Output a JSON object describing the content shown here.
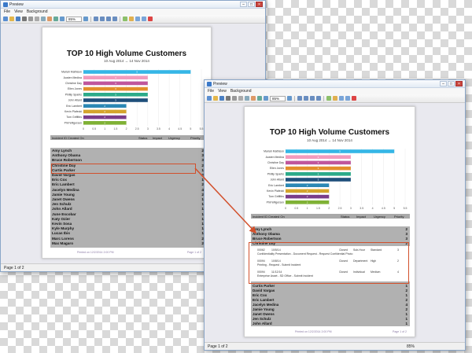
{
  "window_title": "Preview",
  "menu": [
    "File",
    "View",
    "Background"
  ],
  "zoom": "85%",
  "status_left": "Page 1 of 2",
  "report": {
    "title": "TOP 10 High Volume Customers",
    "date_range": "10 Aug 2014  →  14 Nov 2014",
    "columns": [
      "Incident ID",
      "Created On",
      "Status",
      "Impact",
      "Urgency",
      "Priority"
    ],
    "footer_left": "Printed on 12/2/2014 2:00 PM",
    "footer_right": "Page 1 of 2"
  },
  "customers": [
    {
      "name": "Amy Lynch",
      "priority": "2"
    },
    {
      "name": "Anthony Obama",
      "priority": "3"
    },
    {
      "name": "Bruce Robertson",
      "priority": "3"
    },
    {
      "name": "Christine Day",
      "priority": "2"
    },
    {
      "name": "Curtis Parker",
      "priority": "1"
    },
    {
      "name": "David Vargas",
      "priority": "2"
    },
    {
      "name": "Eric Cox",
      "priority": "1"
    },
    {
      "name": "Eric Lambert",
      "priority": "2"
    },
    {
      "name": "Jacelyn Medina",
      "priority": "4"
    },
    {
      "name": "Jamie Young",
      "priority": "2"
    },
    {
      "name": "Janet Owens",
      "priority": "1"
    },
    {
      "name": "Jen Schulz",
      "priority": "1"
    },
    {
      "name": "John Allard",
      "priority": "1"
    },
    {
      "name": "June Escobar",
      "priority": "1"
    },
    {
      "name": "Katy Ozier",
      "priority": "1"
    },
    {
      "name": "Kevin Sosa",
      "priority": "1"
    },
    {
      "name": "Kyle Murphy",
      "priority": "1"
    },
    {
      "name": "Lucas Ibis",
      "priority": "1"
    },
    {
      "name": "Marc Lorens",
      "priority": "2"
    },
    {
      "name": "Max Magaro",
      "priority": "2"
    }
  ],
  "customers_right": [
    {
      "name": "Amy Lynch",
      "priority": "2"
    },
    {
      "name": "Anthony Obama",
      "priority": "3"
    },
    {
      "name": "Bruce Robertson",
      "priority": "3"
    },
    {
      "name": "Christine Day",
      "priority": "2"
    },
    {
      "name": "Curtis Parker",
      "priority": "1"
    },
    {
      "name": "David Vargas",
      "priority": "2"
    },
    {
      "name": "Eric Cox",
      "priority": "1"
    },
    {
      "name": "Eric Lambert",
      "priority": "2"
    },
    {
      "name": "Jacelyn Medina",
      "priority": "4"
    },
    {
      "name": "Jamie Young",
      "priority": "2"
    },
    {
      "name": "Janet Owens",
      "priority": "1"
    },
    {
      "name": "Jen Schulz",
      "priority": "1"
    },
    {
      "name": "John Allard",
      "priority": "1"
    }
  ],
  "detail_rows": [
    {
      "id": "00062",
      "created": "10/5/14",
      "status": "Closed",
      "impact": "Sub-Hour",
      "urgency": "Standard",
      "priority": "3",
      "desc": "Confidentiality Presentation - Document Request - Request Confidential Photo"
    },
    {
      "id": "00094",
      "created": "10/8/14",
      "status": "Closed",
      "impact": "Department",
      "urgency": "High",
      "priority": "2",
      "desc": "Printing - Request - Submit Incident"
    },
    {
      "id": "00094",
      "created": "11/12/14",
      "status": "Closed",
      "impact": "Individual",
      "urgency": "Medium",
      "priority": "4",
      "desc": "Enterprise Asset - SD Office - Submit Incident"
    }
  ],
  "status_right_zoom": "85%",
  "chart_data": {
    "type": "bar",
    "orientation": "horizontal",
    "categories": [
      "Mariah Mathison",
      "Austen Medina",
      "Christine Day",
      "Ellen Jones",
      "Phillip Sparks",
      "John Allard",
      "Eric Lambert",
      "Kevin Plafecki",
      "Tom Griffiths",
      "Phil Wilgersen"
    ],
    "values": [
      5,
      3,
      3,
      3,
      3,
      3,
      2,
      2,
      2,
      2
    ],
    "colors": [
      "#35b6e6",
      "#f29bbd",
      "#c0569c",
      "#e38f2c",
      "#2cab8a",
      "#1f4f7b",
      "#2b88b5",
      "#d4a42c",
      "#7a3c8a",
      "#7fb135"
    ],
    "xlim": [
      0,
      5.5
    ],
    "ticks": [
      "0",
      "0.5",
      "1",
      "1.5",
      "2",
      "2.5",
      "3",
      "3.5",
      "4",
      "4.5",
      "5",
      "5.5"
    ]
  }
}
